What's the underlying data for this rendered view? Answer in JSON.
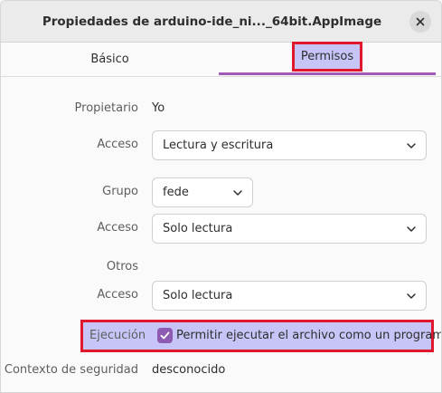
{
  "window": {
    "title": "Propiedades de arduino-ide_ni..._64bit.AppImage",
    "close_icon": "close-icon"
  },
  "tabs": [
    {
      "label": "Básico",
      "selected": false
    },
    {
      "label": "Permisos",
      "selected": true
    }
  ],
  "owner": {
    "label": "Propietario",
    "value": "Yo",
    "access_label": "Acceso",
    "access_value": "Lectura y escritura"
  },
  "group": {
    "label": "Grupo",
    "value": "fede",
    "access_label": "Acceso",
    "access_value": "Solo lectura"
  },
  "others": {
    "label": "Otros",
    "access_label": "Acceso",
    "access_value": "Solo lectura"
  },
  "execution": {
    "label": "Ejecución",
    "checkbox_label": "Permitir ejecutar el archivo como un programa",
    "checked": true
  },
  "security": {
    "label": "Contexto de seguridad",
    "value": "desconocido"
  },
  "colors": {
    "accent": "#8e5bb3",
    "highlight": "#c7c4f7",
    "annotation_border": "#e0182d",
    "tab_underline": "#a15ab6"
  }
}
